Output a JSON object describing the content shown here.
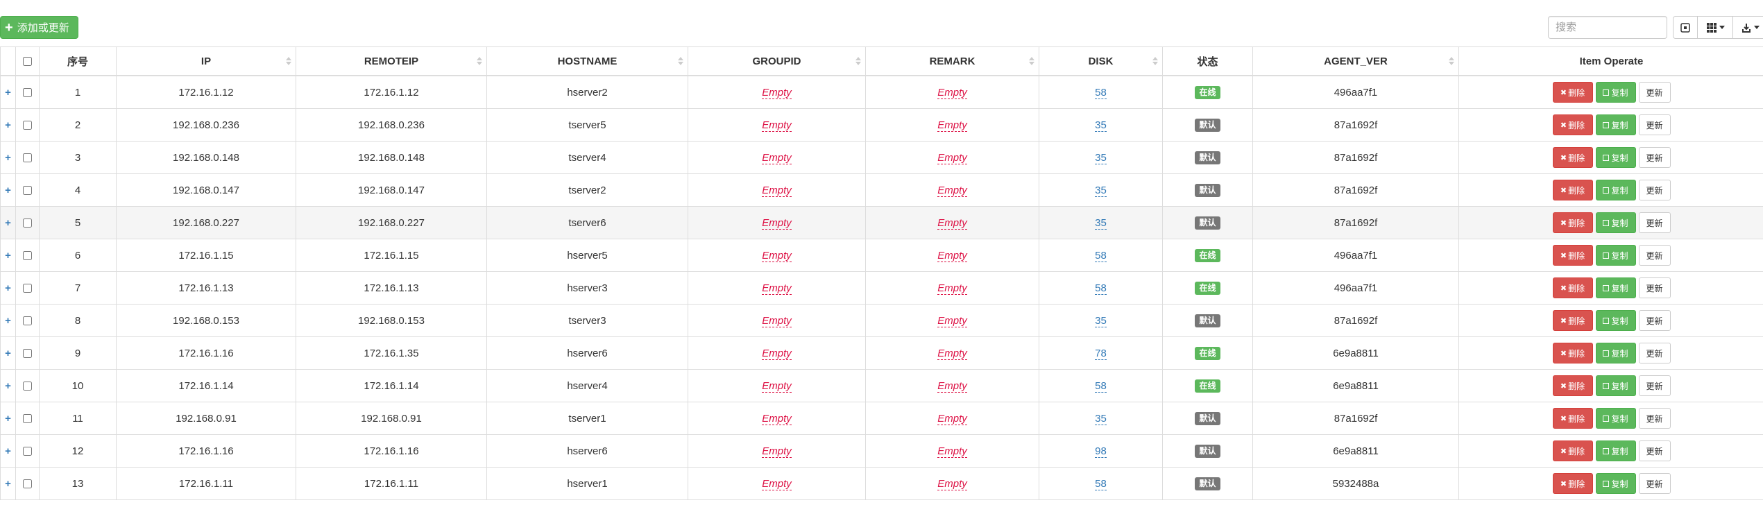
{
  "toolbar": {
    "add_label": "添加或更新",
    "search_placeholder": "搜索"
  },
  "columns": [
    "序号",
    "IP",
    "REMOTEIP",
    "HOSTNAME",
    "GROUPID",
    "REMARK",
    "DISK",
    "状态",
    "AGENT_VER",
    "Item Operate"
  ],
  "actions": {
    "delete": "删除",
    "copy": "复制",
    "update": "更新"
  },
  "colors": {
    "online": "#5cb85c",
    "default": "#777777",
    "delete": "#d9534f",
    "copy": "#5cb85c",
    "empty": "#dd1144",
    "link": "#337ab7"
  },
  "rows": [
    {
      "seq": "1",
      "ip": "172.16.1.12",
      "remoteip": "172.16.1.12",
      "hostname": "hserver2",
      "groupid": "Empty",
      "remark": "Empty",
      "disk": "58",
      "status": "在线",
      "status_type": "online",
      "agent_ver": "496aa7f1"
    },
    {
      "seq": "2",
      "ip": "192.168.0.236",
      "remoteip": "192.168.0.236",
      "hostname": "tserver5",
      "groupid": "Empty",
      "remark": "Empty",
      "disk": "35",
      "status": "默认",
      "status_type": "default",
      "agent_ver": "87a1692f"
    },
    {
      "seq": "3",
      "ip": "192.168.0.148",
      "remoteip": "192.168.0.148",
      "hostname": "tserver4",
      "groupid": "Empty",
      "remark": "Empty",
      "disk": "35",
      "status": "默认",
      "status_type": "default",
      "agent_ver": "87a1692f"
    },
    {
      "seq": "4",
      "ip": "192.168.0.147",
      "remoteip": "192.168.0.147",
      "hostname": "tserver2",
      "groupid": "Empty",
      "remark": "Empty",
      "disk": "35",
      "status": "默认",
      "status_type": "default",
      "agent_ver": "87a1692f"
    },
    {
      "seq": "5",
      "ip": "192.168.0.227",
      "remoteip": "192.168.0.227",
      "hostname": "tserver6",
      "groupid": "Empty",
      "remark": "Empty",
      "disk": "35",
      "status": "默认",
      "status_type": "default",
      "agent_ver": "87a1692f",
      "highlight": true
    },
    {
      "seq": "6",
      "ip": "172.16.1.15",
      "remoteip": "172.16.1.15",
      "hostname": "hserver5",
      "groupid": "Empty",
      "remark": "Empty",
      "disk": "58",
      "status": "在线",
      "status_type": "online",
      "agent_ver": "496aa7f1"
    },
    {
      "seq": "7",
      "ip": "172.16.1.13",
      "remoteip": "172.16.1.13",
      "hostname": "hserver3",
      "groupid": "Empty",
      "remark": "Empty",
      "disk": "58",
      "status": "在线",
      "status_type": "online",
      "agent_ver": "496aa7f1"
    },
    {
      "seq": "8",
      "ip": "192.168.0.153",
      "remoteip": "192.168.0.153",
      "hostname": "tserver3",
      "groupid": "Empty",
      "remark": "Empty",
      "disk": "35",
      "status": "默认",
      "status_type": "default",
      "agent_ver": "87a1692f"
    },
    {
      "seq": "9",
      "ip": "172.16.1.16",
      "remoteip": "172.16.1.35",
      "hostname": "hserver6",
      "groupid": "Empty",
      "remark": "Empty",
      "disk": "78",
      "status": "在线",
      "status_type": "online",
      "agent_ver": "6e9a8811"
    },
    {
      "seq": "10",
      "ip": "172.16.1.14",
      "remoteip": "172.16.1.14",
      "hostname": "hserver4",
      "groupid": "Empty",
      "remark": "Empty",
      "disk": "58",
      "status": "在线",
      "status_type": "online",
      "agent_ver": "6e9a8811"
    },
    {
      "seq": "11",
      "ip": "192.168.0.91",
      "remoteip": "192.168.0.91",
      "hostname": "tserver1",
      "groupid": "Empty",
      "remark": "Empty",
      "disk": "35",
      "status": "默认",
      "status_type": "default",
      "agent_ver": "87a1692f"
    },
    {
      "seq": "12",
      "ip": "172.16.1.16",
      "remoteip": "172.16.1.16",
      "hostname": "hserver6",
      "groupid": "Empty",
      "remark": "Empty",
      "disk": "98",
      "status": "默认",
      "status_type": "default",
      "agent_ver": "6e9a8811"
    },
    {
      "seq": "13",
      "ip": "172.16.1.11",
      "remoteip": "172.16.1.11",
      "hostname": "hserver1",
      "groupid": "Empty",
      "remark": "Empty",
      "disk": "58",
      "status": "默认",
      "status_type": "default",
      "agent_ver": "5932488a"
    }
  ]
}
